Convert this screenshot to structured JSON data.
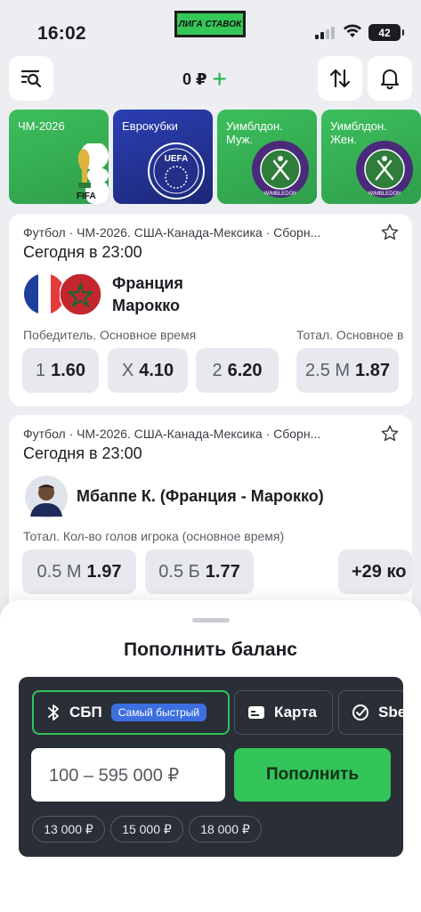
{
  "status": {
    "time": "16:02",
    "brand": "ЛИГА СТАВОК",
    "battery": "42"
  },
  "topbar": {
    "balance": "0 ₽",
    "plus": "+"
  },
  "categories": [
    {
      "label": "ЧМ-2026",
      "logo_text": "FIFA"
    },
    {
      "label": "Еврокубки",
      "logo_text": "UEFA"
    },
    {
      "label": "Уимблдон. Муж.",
      "logo_text": "WIMBLEDON"
    },
    {
      "label": "Уимблдон. Жен.",
      "logo_text": "WIMBLEDON"
    }
  ],
  "events": [
    {
      "league": "Футбол · ЧМ-2026. США-Канада-Мексика · Сборн...",
      "when": "Сегодня в 23:00",
      "team1": "Франция",
      "team2": "Марокко",
      "market1": "Победитель. Основное время",
      "market2": "Тотал. Основное в",
      "odds": [
        {
          "k": "1",
          "v": "1.60"
        },
        {
          "k": "X",
          "v": "4.10"
        },
        {
          "k": "2",
          "v": "6.20"
        },
        {
          "k": "2.5 М",
          "v": "1.87"
        }
      ]
    },
    {
      "league": "Футбол · ЧМ-2026. США-Канада-Мексика · Сборн...",
      "when": "Сегодня в 23:00",
      "player": "Мбаппе К. (Франция - Марокко)",
      "market1": "Тотал. Кол-во голов игрока (основное время)",
      "odds": [
        {
          "k": "0.5 М",
          "v": "1.97"
        },
        {
          "k": "0.5 Б",
          "v": "1.77"
        }
      ],
      "more": "+29 ко"
    }
  ],
  "sheet": {
    "title": "Пополнить баланс",
    "tabs": [
      {
        "label": "СБП",
        "badge": "Самый быстрый"
      },
      {
        "label": "Карта"
      },
      {
        "label": "Sbe"
      }
    ],
    "amount_placeholder": "100 – 595 000 ₽",
    "topup_label": "Пополнить",
    "presets": [
      "13 000 ₽",
      "15 000 ₽",
      "18 000 ₽"
    ]
  },
  "colors": {
    "accent": "#33c45a",
    "badge": "#3d6fe0",
    "panel": "#2a2e36"
  }
}
